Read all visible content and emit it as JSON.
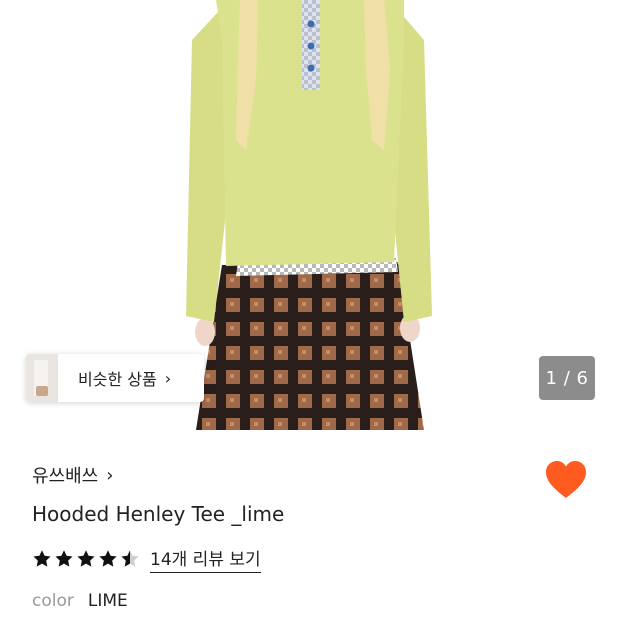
{
  "similar_products": {
    "label": "비슷한 상품"
  },
  "gallery": {
    "counter": "1 / 6",
    "current_page": 1,
    "total_pages": 6
  },
  "brand": {
    "name": "유쓰배쓰"
  },
  "product": {
    "title": "Hooded Henley Tee _lime",
    "rating": 4.5,
    "review_link": "14개 리뷰 보기",
    "color_label": "color",
    "color_value": "LIME"
  },
  "like": {
    "liked": true,
    "color": "#ff5a1f"
  },
  "colors": {
    "sweater": "#d9e08c",
    "skirt_dark": "#2a1e1a",
    "skirt_light": "#a06a4a"
  },
  "icons": {
    "chevron": "chevron-right-icon",
    "heart": "heart-icon",
    "star": "star-icon"
  }
}
